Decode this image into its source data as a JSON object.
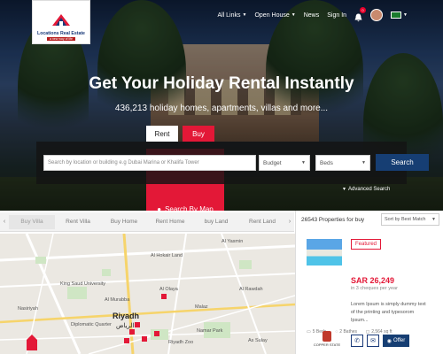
{
  "brand": {
    "logo_name": "Locations Real Estate",
    "logo_tagline": "a new way of life"
  },
  "nav": {
    "all_links": "All Links",
    "open_house": "Open House",
    "news": "News",
    "sign_in": "Sign In",
    "notification_count": "0"
  },
  "hero": {
    "headline": "Get Your Holiday Rental Instantly",
    "subline": "436,213 holiday homes, apartments, villas and more..."
  },
  "search_tabs": {
    "rent": "Rent",
    "buy": "Buy",
    "map": "Search By Map"
  },
  "search": {
    "location_placeholder": "Search by location or building e.g Dubai Marina or Khalifa Tower",
    "budget": "Budget",
    "beds": "Beds",
    "button": "Search",
    "advanced": "Advanced Search"
  },
  "property_tabs": [
    "Buy Villa",
    "Rent Villa",
    "Buy Home",
    "Rent Home",
    "buy Land",
    "Rent Land"
  ],
  "map": {
    "city": "Riyadh",
    "city_ar": "الرياض",
    "labels": [
      "Al Hokair Land",
      "King Saud University",
      "Al Olaya",
      "Malaz",
      "Nasiriyah",
      "Namar Park",
      "Riyadh Zoo",
      "Diplomatic Quarter",
      "Al Murabba",
      "Al Yasmin",
      "Al Rawdah",
      "As Sulay"
    ]
  },
  "listings": {
    "count_text": "26543 Properties for buy",
    "sort": "Sort by Best Match",
    "card": {
      "badge": "Featured",
      "price": "SAR 26,249",
      "cheques": "in 3 cheques per year",
      "description": "Lorem Ipsum is simply dummy text of the printing and typesorom Ipsum...",
      "beds": "5 Beds",
      "baths": "2 Bathes",
      "area": "2,564 sq ft",
      "brand": "COPPER STATE",
      "offer": "Offer"
    }
  },
  "colors": {
    "accent_red": "#e31837",
    "navy": "#163e73"
  }
}
